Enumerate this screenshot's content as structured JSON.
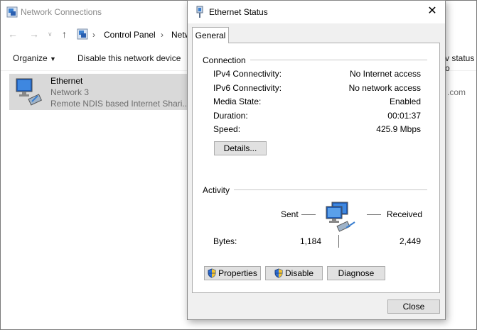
{
  "background_window": {
    "title": "Network Connections",
    "address": {
      "crumb1": "Control Panel",
      "crumb2": "Netw"
    },
    "commands": {
      "organize": "Organize",
      "disable": "Disable this network device"
    },
    "adapter": {
      "name": "Ethernet",
      "network": "Network 3",
      "device": "Remote NDIS based Internet Shari..."
    },
    "right_fragments": {
      "status": "v status o",
      "domain": ".com"
    }
  },
  "dialog": {
    "title": "Ethernet Status",
    "tab": "General",
    "connection": {
      "header": "Connection",
      "rows": [
        {
          "label": "IPv4 Connectivity:",
          "value": "No Internet access"
        },
        {
          "label": "IPv6 Connectivity:",
          "value": "No network access"
        },
        {
          "label": "Media State:",
          "value": "Enabled"
        },
        {
          "label": "Duration:",
          "value": "00:01:37"
        },
        {
          "label": "Speed:",
          "value": "425.9 Mbps"
        }
      ],
      "details_button": "Details..."
    },
    "activity": {
      "header": "Activity",
      "sent_label": "Sent",
      "received_label": "Received",
      "bytes_label": "Bytes:",
      "bytes_sent": "1,184",
      "bytes_received": "2,449"
    },
    "buttons": {
      "properties": "Properties",
      "disable": "Disable",
      "diagnose": "Diagnose",
      "close": "Close"
    }
  },
  "icons": [
    "network-connections-icon",
    "ethernet-status-icon",
    "ethernet-adapter-icon",
    "network-activity-icon",
    "shield-icon"
  ]
}
